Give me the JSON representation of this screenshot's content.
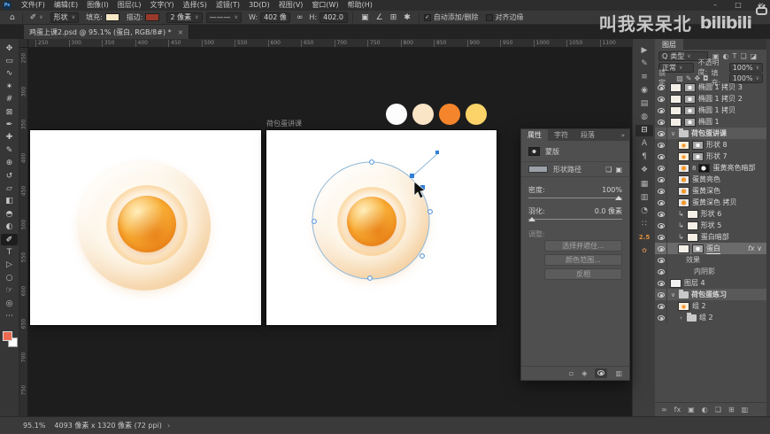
{
  "chrome": {
    "logo": "Ps",
    "menus": [
      "文件(F)",
      "编辑(E)",
      "图像(I)",
      "图层(L)",
      "文字(Y)",
      "选择(S)",
      "滤镜(T)",
      "3D(D)",
      "视图(V)",
      "窗口(W)",
      "帮助(H)"
    ],
    "window_controls": [
      {
        "name": "minimize-button",
        "glyph": "–"
      },
      {
        "name": "maximize-button",
        "glyph": "□"
      },
      {
        "name": "close-button",
        "glyph": "×"
      }
    ]
  },
  "watermark": {
    "text": "叫我呆呆北",
    "logo": "bilibili"
  },
  "options_bar": {
    "home_icon": "⌂",
    "tool_icon": "✐",
    "caret": "∨",
    "mode_value": "形状",
    "fill_label": "填充:",
    "fill_color": "#f7e7c6",
    "stroke_label": "描边:",
    "stroke_color": "#99392b",
    "stroke_width": "2 像素",
    "stroke_style": "———",
    "w_label": "W:",
    "w_value": "402 像",
    "link_icon": "∞",
    "h_label": "H:",
    "h_value": "402.0",
    "ops_icons": [
      {
        "name": "path-operations-icon",
        "glyph": "▣"
      },
      {
        "name": "path-alignment-icon",
        "glyph": "∠"
      },
      {
        "name": "path-arrangement-icon",
        "glyph": "⊞"
      },
      {
        "name": "gear-icon",
        "glyph": "✱"
      }
    ],
    "checkbox1": {
      "label": "自动添加/删除",
      "checked": true
    },
    "checkbox2": {
      "label": "对齐边缘",
      "checked": false
    }
  },
  "document_tab": {
    "title": "鸡蛋上课2.psd @ 95.1% (蛋白, RGB/8#) *",
    "close_icon": "×"
  },
  "rulers": {
    "horizontal": [
      "250",
      "300",
      "350",
      "400",
      "450",
      "500",
      "550",
      "600",
      "650",
      "700",
      "750",
      "800",
      "850",
      "900",
      "950",
      "1000",
      "1050",
      "1100"
    ],
    "vertical": [
      "250",
      "300",
      "350",
      "400",
      "450",
      "500",
      "550",
      "600",
      "650",
      "700",
      "750"
    ]
  },
  "canvas": {
    "artboard_label": "荷包蛋讲课",
    "palette": [
      "#fdfdfd",
      "#fae5c7",
      "#f5852c",
      "#fbd369"
    ],
    "egg_colors": {
      "white": "#fdf6ea",
      "rim": "#f2d2a2",
      "yolk_light": "#ffedbb",
      "yolk_mid": "#f7a930",
      "yolk_deep": "#ed8213"
    },
    "path_color": "#8fb8d8",
    "anchor_color": "#2f7fd6"
  },
  "tools": [
    {
      "name": "move-tool-icon",
      "glyph": "✥"
    },
    {
      "name": "marquee-tool-icon",
      "glyph": "▭"
    },
    {
      "name": "lasso-tool-icon",
      "glyph": "∿"
    },
    {
      "name": "quick-selection-tool-icon",
      "glyph": "✶"
    },
    {
      "name": "crop-tool-icon",
      "glyph": "#"
    },
    {
      "name": "frame-tool-icon",
      "glyph": "⊠"
    },
    {
      "name": "eyedropper-tool-icon",
      "glyph": "✒"
    },
    {
      "name": "healing-brush-tool-icon",
      "glyph": "✚"
    },
    {
      "name": "brush-tool-icon",
      "glyph": "✎"
    },
    {
      "name": "clone-stamp-tool-icon",
      "glyph": "⊕"
    },
    {
      "name": "history-brush-tool-icon",
      "glyph": "↺"
    },
    {
      "name": "eraser-tool-icon",
      "glyph": "▱"
    },
    {
      "name": "gradient-tool-icon",
      "glyph": "◧"
    },
    {
      "name": "blur-tool-icon",
      "glyph": "◓"
    },
    {
      "name": "dodge-tool-icon",
      "glyph": "◐"
    },
    {
      "name": "pen-tool-icon",
      "glyph": "✐",
      "active": true
    },
    {
      "name": "type-tool-icon",
      "glyph": "T"
    },
    {
      "name": "path-selection-tool-icon",
      "glyph": "▷"
    },
    {
      "name": "shape-tool-icon",
      "glyph": "○"
    },
    {
      "name": "hand-tool-icon",
      "glyph": "☞"
    },
    {
      "name": "zoom-tool-icon",
      "glyph": "◎"
    },
    {
      "name": "edit-toolbar-icon",
      "glyph": "⋯"
    }
  ],
  "tool_colors": {
    "foreground": "#ec6a52",
    "background": "#ffffff"
  },
  "dock_icons": [
    {
      "name": "actions-panel-icon",
      "glyph": "▶"
    },
    {
      "name": "brushes-panel-icon",
      "glyph": "✎"
    },
    {
      "name": "brush-settings-panel-icon",
      "glyph": "≡"
    },
    {
      "name": "learn-panel-icon",
      "glyph": "◉"
    },
    {
      "name": "clone-source-panel-icon",
      "glyph": "▤"
    },
    {
      "name": "libraries-panel-icon",
      "glyph": "◍"
    },
    {
      "name": "properties-panel-icon",
      "glyph": "⊟",
      "active": true
    },
    {
      "name": "character-panel-icon",
      "glyph": "A"
    },
    {
      "name": "paragraph-panel-icon",
      "glyph": "¶"
    },
    {
      "name": "swatches-panel-icon",
      "glyph": "❖"
    },
    {
      "name": "patterns-panel-icon",
      "glyph": "▦"
    },
    {
      "name": "gradients-panel-icon",
      "glyph": "▥"
    },
    {
      "name": "histogram-panel-icon",
      "glyph": "◔"
    },
    {
      "name": "info-panel-icon",
      "glyph": "∷"
    },
    {
      "name": "version-badge",
      "glyph": "2.5",
      "color": "#e8923f"
    },
    {
      "name": "custom-brush-icon",
      "glyph": "✿",
      "color": "#c08552"
    }
  ],
  "properties_panel": {
    "tabs": [
      "属性",
      "字符",
      "段落"
    ],
    "collapse_icon": "»",
    "mask_title": "蒙版",
    "shape_path_label": "形状路径",
    "header_icons": [
      {
        "name": "add-pixel-mask-icon",
        "glyph": "❏"
      },
      {
        "name": "add-vector-mask-icon",
        "glyph": "▣"
      }
    ],
    "density_label": "密度:",
    "density_value": "100%",
    "feather_label": "羽化:",
    "feather_value": "0.0 像素",
    "refine_label": "调整:",
    "buttons": [
      "选择并遮住...",
      "颜色范围...",
      "反相"
    ],
    "footer_icons": [
      {
        "name": "load-selection-icon",
        "glyph": "▫"
      },
      {
        "name": "apply-mask-icon",
        "glyph": "◈"
      },
      {
        "name": "toggle-mask-eye-icon",
        "glyph": "eye",
        "active": true
      },
      {
        "name": "delete-mask-icon",
        "glyph": "▥"
      }
    ]
  },
  "layers_panel": {
    "tab_title": "图层",
    "search_icon": "Q",
    "filter_value": "类型",
    "caret": "∨",
    "filter_icons": [
      {
        "name": "filter-pixel-icon",
        "glyph": "▣"
      },
      {
        "name": "filter-adjustment-icon",
        "glyph": "◐"
      },
      {
        "name": "filter-type-icon",
        "glyph": "T"
      },
      {
        "name": "filter-shape-icon",
        "glyph": "❏"
      },
      {
        "name": "filter-smartobject-icon",
        "glyph": "◪"
      }
    ],
    "blend_mode": "正常",
    "opacity_label": "不透明度:",
    "opacity_value": "100%",
    "lock_label": "锁定:",
    "lock_icons": [
      {
        "name": "lock-transparency-icon",
        "glyph": "▨"
      },
      {
        "name": "lock-paint-icon",
        "glyph": "✎"
      },
      {
        "name": "lock-move-icon",
        "glyph": "✥"
      },
      {
        "name": "lock-all-icon",
        "glyph": "◘"
      }
    ],
    "fill_label": "填充:",
    "fill_value": "100%",
    "layers": [
      {
        "name": "椭圆 1 拷贝 3",
        "thumbs": [
          "white",
          "path"
        ],
        "indent": 0
      },
      {
        "name": "椭圆 1 拷贝 2",
        "thumbs": [
          "white",
          "path"
        ],
        "indent": 0
      },
      {
        "name": "椭圆 1 拷贝",
        "thumbs": [
          "white",
          "path"
        ],
        "indent": 0
      },
      {
        "name": "椭圆 1",
        "thumbs": [
          "white",
          "path"
        ],
        "indent": 0
      },
      {
        "name": "荷包蛋讲课",
        "group": "open",
        "indent": 0,
        "emph": true
      },
      {
        "name": "形状 8",
        "thumbs": [
          "egg",
          "path"
        ],
        "indent": 1
      },
      {
        "name": "形状 7",
        "thumbs": [
          "egg",
          "path"
        ],
        "indent": 1
      },
      {
        "name": "蛋黄亮色暗部",
        "thumbs": [
          "yolk",
          "mask"
        ],
        "linked": true,
        "indent": 1
      },
      {
        "name": "蛋黄亮色",
        "thumbs": [
          "yolk"
        ],
        "indent": 1
      },
      {
        "name": "蛋黄深色",
        "thumbs": [
          "yolk"
        ],
        "indent": 1
      },
      {
        "name": "蛋黄深色 拷贝",
        "thumbs": [
          "yolk"
        ],
        "indent": 1
      },
      {
        "name": "形状 6",
        "thumbs": [
          "white"
        ],
        "clipped": true,
        "indent": 1
      },
      {
        "name": "形状 5",
        "thumbs": [
          "white"
        ],
        "clipped": true,
        "indent": 1
      },
      {
        "name": "蛋白暗部",
        "thumbs": [
          "white"
        ],
        "clipped": true,
        "indent": 1
      },
      {
        "name": "蛋白",
        "thumbs": [
          "white",
          "path"
        ],
        "indent": 1,
        "selected": true,
        "fx": true
      },
      {
        "name": "效果",
        "effect": true,
        "indent": 2
      },
      {
        "name": "内阴影",
        "effect": true,
        "indent": 3
      },
      {
        "name": "图层 4",
        "thumbs": [
          "plain"
        ],
        "indent": 0
      },
      {
        "name": "荷包蛋练习",
        "group": "open",
        "indent": 0,
        "emph": true
      },
      {
        "name": "组 2",
        "thumbs": [
          "egg"
        ],
        "indent": 1
      },
      {
        "name": "组 2",
        "group": "closed",
        "indent": 1
      }
    ],
    "fx_label": "fx",
    "footer_icons": [
      {
        "name": "link-layers-icon",
        "glyph": "∞"
      },
      {
        "name": "layer-style-icon",
        "glyph": "fx"
      },
      {
        "name": "add-mask-icon",
        "glyph": "▣"
      },
      {
        "name": "adjustment-layer-icon",
        "glyph": "◐"
      },
      {
        "name": "new-group-icon",
        "glyph": "❏"
      },
      {
        "name": "new-layer-icon",
        "glyph": "⊞"
      },
      {
        "name": "delete-layer-icon",
        "glyph": "▥"
      }
    ]
  },
  "status_bar": {
    "zoom": "95.1%",
    "doc_info": "4093 像素 x 1320 像素 (72 ppi)",
    "chevron": "›"
  }
}
